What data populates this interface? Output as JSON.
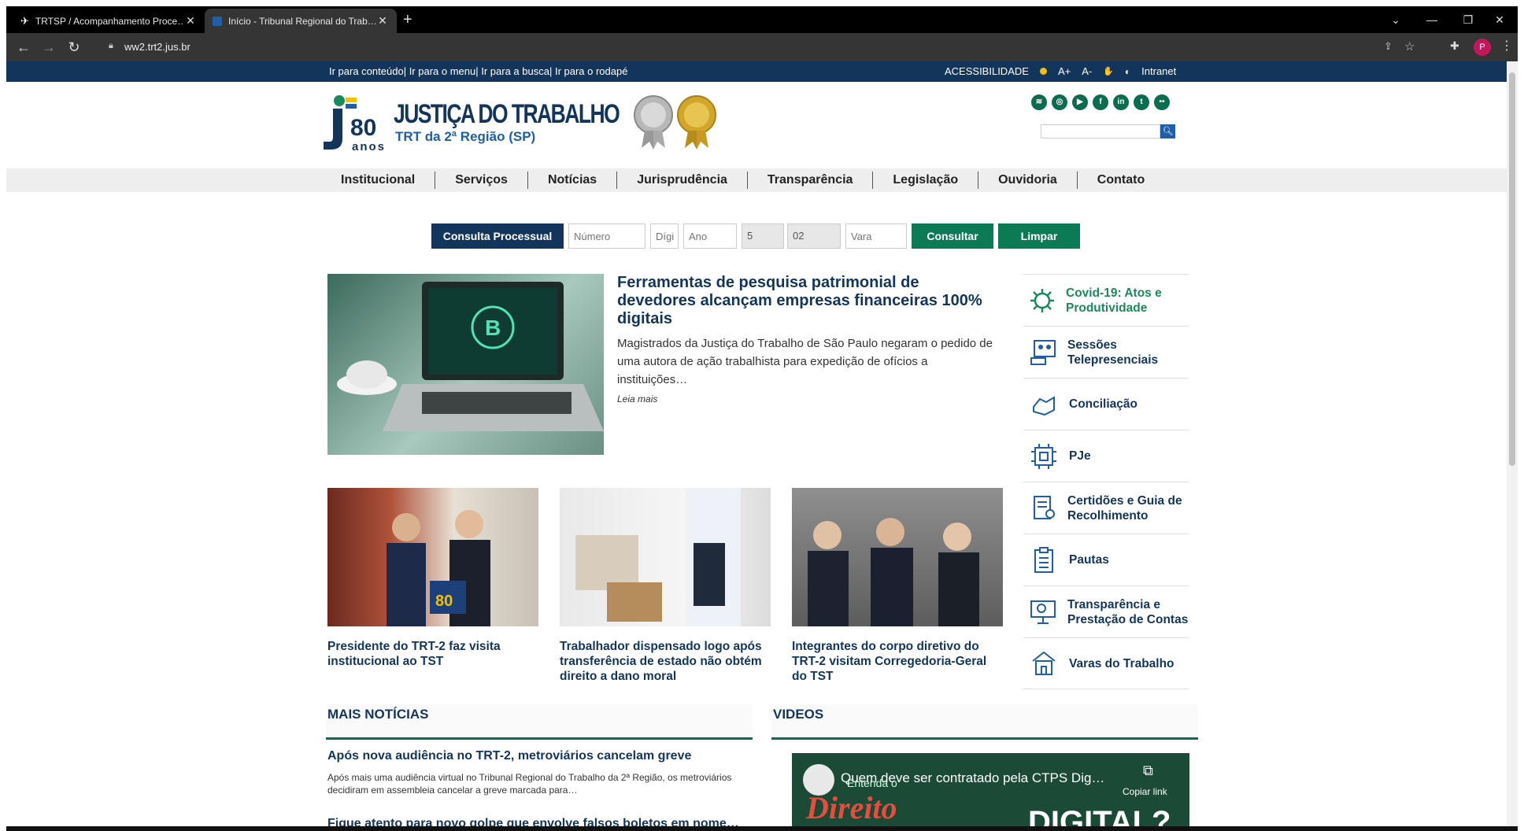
{
  "browser": {
    "tabs": [
      {
        "title": "TRTSP / Acompanhamento Proce…",
        "active": false
      },
      {
        "title": "Início - Tribunal Regional do Trab…",
        "active": true
      }
    ],
    "new_tab": "+",
    "url": "ww2.trt2.jus.br",
    "profile_initial": "P"
  },
  "topbar": {
    "skip_links": [
      "Ir para conteúdo",
      "Ir para o menu",
      "Ir para a busca",
      "Ir para o rodapé"
    ],
    "acessibilidade": "ACESSIBILIDADE",
    "font_plus": "A+",
    "font_minus": "A-",
    "intranet": "Intranet"
  },
  "header": {
    "logo_80": "80",
    "logo_anos": "anos",
    "logo_title": "JUSTIÇA DO TRABALHO",
    "logo_subtitle": "TRT da 2ª Região (SP)",
    "social_icons": [
      "rss-icon",
      "instagram-icon",
      "youtube-icon",
      "facebook-icon",
      "linkedin-icon",
      "twitter-icon",
      "flickr-icon"
    ]
  },
  "menu": [
    "Institucional",
    "Serviços",
    "Notícias",
    "Jurisprudência",
    "Transparência",
    "Legislação",
    "Ouvidoria",
    "Contato"
  ],
  "consulta": {
    "label": "Consulta Processual",
    "numero_placeholder": "Número",
    "digito_placeholder": "Dígi",
    "ano_placeholder": "Ano",
    "justica_value": "5",
    "tribunal_value": "02",
    "vara_placeholder": "Vara",
    "consultar": "Consultar",
    "limpar": "Limpar"
  },
  "main_news": {
    "title": "Ferramentas de pesquisa patrimonial de devedores alcançam empresas financeiras 100% digitais",
    "description": "Magistrados da Justiça do Trabalho de São Paulo negaram o pedido de uma autora de ação trabalhista para expedição de ofícios a instituições…",
    "read_more": "Leia mais"
  },
  "sub_news": [
    {
      "title": "Presidente do TRT-2 faz visita institucional ao TST"
    },
    {
      "title": "Trabalhador dispensado logo após transferência de estado não obtém direito a dano moral"
    },
    {
      "title": "Integrantes do corpo diretivo do TRT-2 visitam Corregedoria-Geral do TST"
    }
  ],
  "side_menu": [
    {
      "label": "Covid-19: Atos e Produtividade",
      "icon": "virus-icon"
    },
    {
      "label": "Sessões Telepresenciais",
      "icon": "video-conference-icon"
    },
    {
      "label": "Conciliação",
      "icon": "handshake-icon"
    },
    {
      "label": "PJe",
      "icon": "chip-icon"
    },
    {
      "label": "Certidões e Guia de Recolhimento",
      "icon": "certificate-icon"
    },
    {
      "label": "Pautas",
      "icon": "clipboard-icon"
    },
    {
      "label": "Transparência e Prestação de Contas",
      "icon": "monitor-search-icon"
    },
    {
      "label": "Varas do Trabalho",
      "icon": "building-icon"
    }
  ],
  "sections": {
    "mais_noticias": "MAIS NOTÍCIAS",
    "videos": "VIDEOS"
  },
  "more_news": [
    {
      "title": "Após nova audiência no TRT-2, metroviários cancelam greve",
      "description": "Após mais uma audiência virtual no Tribunal Regional do Trabalho da 2ª Região, os metroviários decidiram em assembleia cancelar a greve marcada para…"
    },
    {
      "title": "Fique atento para novo golpe que envolve falsos boletos em nome…"
    }
  ],
  "video": {
    "title": "Quem deve ser contratado pela CTPS Dig…",
    "copy_link": "Copiar link",
    "overlay_word": "Direito",
    "overlay_small": "Entenda o",
    "overlay_right": "DIGITAL?"
  },
  "colors": {
    "navy": "#13355c",
    "green": "#0b7a55",
    "teal": "#1a8a5a"
  }
}
